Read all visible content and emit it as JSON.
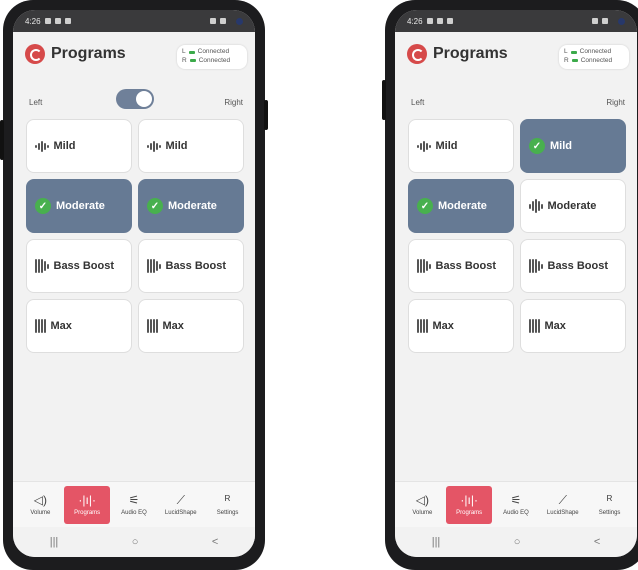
{
  "status": {
    "time": "4:26"
  },
  "header": {
    "title": "Programs"
  },
  "connection": {
    "left_label": "L",
    "left_status": "Connected",
    "right_label": "R",
    "right_status": "Connected"
  },
  "sides": {
    "left": "Left",
    "right": "Right"
  },
  "programs": [
    "Mild",
    "Moderate",
    "Bass Boost",
    "Max"
  ],
  "screens": [
    {
      "toggle_visible": true,
      "toggle_on": true,
      "selected_left": "Moderate",
      "selected_right": "Moderate"
    },
    {
      "toggle_visible": false,
      "selected_left": "Moderate",
      "selected_right": "Mild"
    }
  ],
  "tabs": [
    {
      "label": "Volume",
      "icon": "speaker-icon"
    },
    {
      "label": "Programs",
      "icon": "waveform-icon",
      "active": true
    },
    {
      "label": "Audio EQ",
      "icon": "sliders-icon"
    },
    {
      "label": "LucidShape",
      "icon": "chart-icon"
    },
    {
      "label": "Settings",
      "icon": "person-icon"
    }
  ],
  "navbar": {
    "recents": "|||",
    "home": "○",
    "back": "<"
  },
  "colors": {
    "selected": "#667a94",
    "active_tab": "#e45566",
    "check": "#48b04e",
    "logo": "#d64a4a"
  }
}
